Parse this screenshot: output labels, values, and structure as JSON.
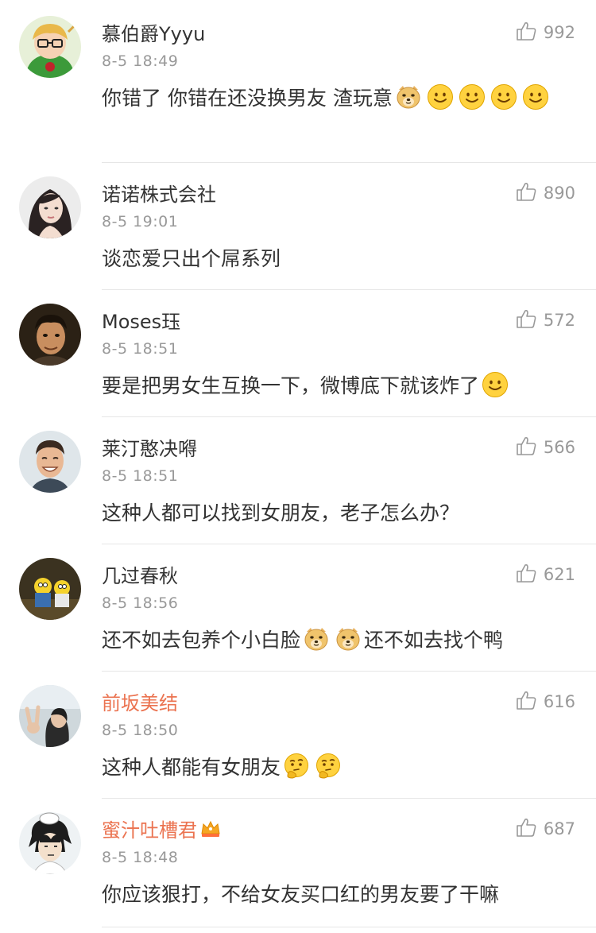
{
  "comments": [
    {
      "username": "慕伯爵Yyyu",
      "time": "8-5 18:49",
      "likes": "992",
      "avatar": "avatar-green-hood-icon",
      "content": [
        {
          "t": "text",
          "v": "你错了 你错在还没换男友  渣玩意"
        },
        {
          "t": "emoji",
          "v": "doge-emoji-icon"
        },
        {
          "t": "emoji",
          "v": "smile-emoji-icon"
        },
        {
          "t": "emoji",
          "v": "smile-emoji-icon"
        },
        {
          "t": "emoji",
          "v": "smile-emoji-icon"
        },
        {
          "t": "emoji",
          "v": "smile-emoji-icon"
        }
      ]
    },
    {
      "username": "诺诺株式会社",
      "time": "8-5 19:01",
      "likes": "890",
      "avatar": "avatar-girl-icon",
      "content": [
        {
          "t": "text",
          "v": "谈恋爱只出个屌系列"
        }
      ]
    },
    {
      "username": "Moses珏",
      "time": "8-5 18:51",
      "likes": "572",
      "avatar": "avatar-man-dark-icon",
      "content": [
        {
          "t": "text",
          "v": "要是把男女生互换一下，微博底下就该炸了"
        },
        {
          "t": "emoji",
          "v": "smile-emoji-icon"
        }
      ]
    },
    {
      "username": "莱汀憨决嘚",
      "time": "8-5 18:51",
      "likes": "566",
      "avatar": "avatar-man-smile-icon",
      "content": [
        {
          "t": "text",
          "v": "这种人都可以找到女朋友，老子怎么办？"
        }
      ]
    },
    {
      "username": "几过春秋",
      "time": "8-5 18:56",
      "likes": "621",
      "avatar": "avatar-cartoon-icon",
      "content": [
        {
          "t": "text",
          "v": "还不如去包养个小白脸"
        },
        {
          "t": "emoji",
          "v": "doge-emoji-icon"
        },
        {
          "t": "emoji",
          "v": "doge-emoji-icon"
        },
        {
          "t": "text",
          "v": "还不如去找个鸭"
        }
      ]
    },
    {
      "username": "前坂美结",
      "time": "8-5 18:50",
      "likes": "616",
      "vip": true,
      "avatar": "avatar-peace-sign-icon",
      "content": [
        {
          "t": "text",
          "v": "这种人都能有女朋友"
        },
        {
          "t": "emoji",
          "v": "thinking-emoji-icon"
        },
        {
          "t": "emoji",
          "v": "thinking-emoji-icon"
        }
      ]
    },
    {
      "username": "蜜汁吐槽君",
      "time": "8-5 18:48",
      "likes": "687",
      "vip": true,
      "crown": true,
      "avatar": "avatar-anime-boy-icon",
      "content": [
        {
          "t": "text",
          "v": "你应该狠打，不给女友买口红的男友要了干嘛"
        }
      ]
    }
  ],
  "colors": {
    "vip_name": "#eb7350",
    "muted": "#999999",
    "text": "#333333",
    "divider": "#e6e6e6"
  }
}
